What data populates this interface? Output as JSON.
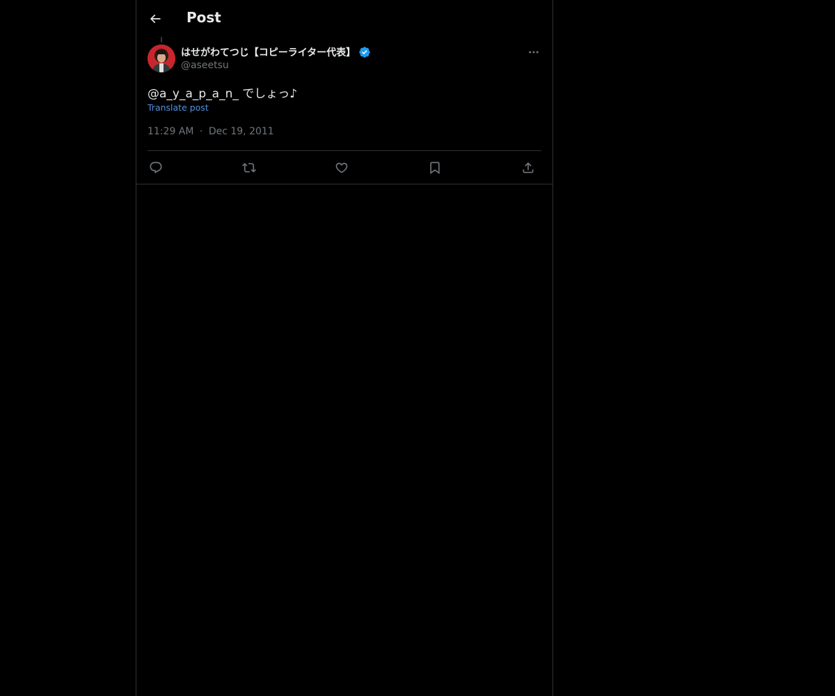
{
  "header": {
    "title": "Post",
    "back_icon": "arrow-left-icon"
  },
  "tweet": {
    "author": {
      "display_name": "はせがわてつじ【コピーライター代表】",
      "handle": "@aseetsu",
      "verified": true,
      "verified_color": "#1d9bf0"
    },
    "text": {
      "mention": "@a_y_a_p_a_n_",
      "body": " でしょっ♪"
    },
    "translate_label": "Translate post",
    "time": "11:29 AM",
    "separator": "·",
    "date": "Dec 19, 2011"
  },
  "actions": [
    {
      "name": "reply",
      "icon": "reply-icon"
    },
    {
      "name": "repost",
      "icon": "repost-icon"
    },
    {
      "name": "like",
      "icon": "heart-icon"
    },
    {
      "name": "bookmark",
      "icon": "bookmark-icon"
    },
    {
      "name": "share",
      "icon": "share-icon"
    }
  ],
  "colors": {
    "background": "#000000",
    "text_primary": "#e7e9ea",
    "text_secondary": "#71767b",
    "link": "#4f93e0",
    "border": "#2f3336",
    "icon": "#71767b"
  }
}
